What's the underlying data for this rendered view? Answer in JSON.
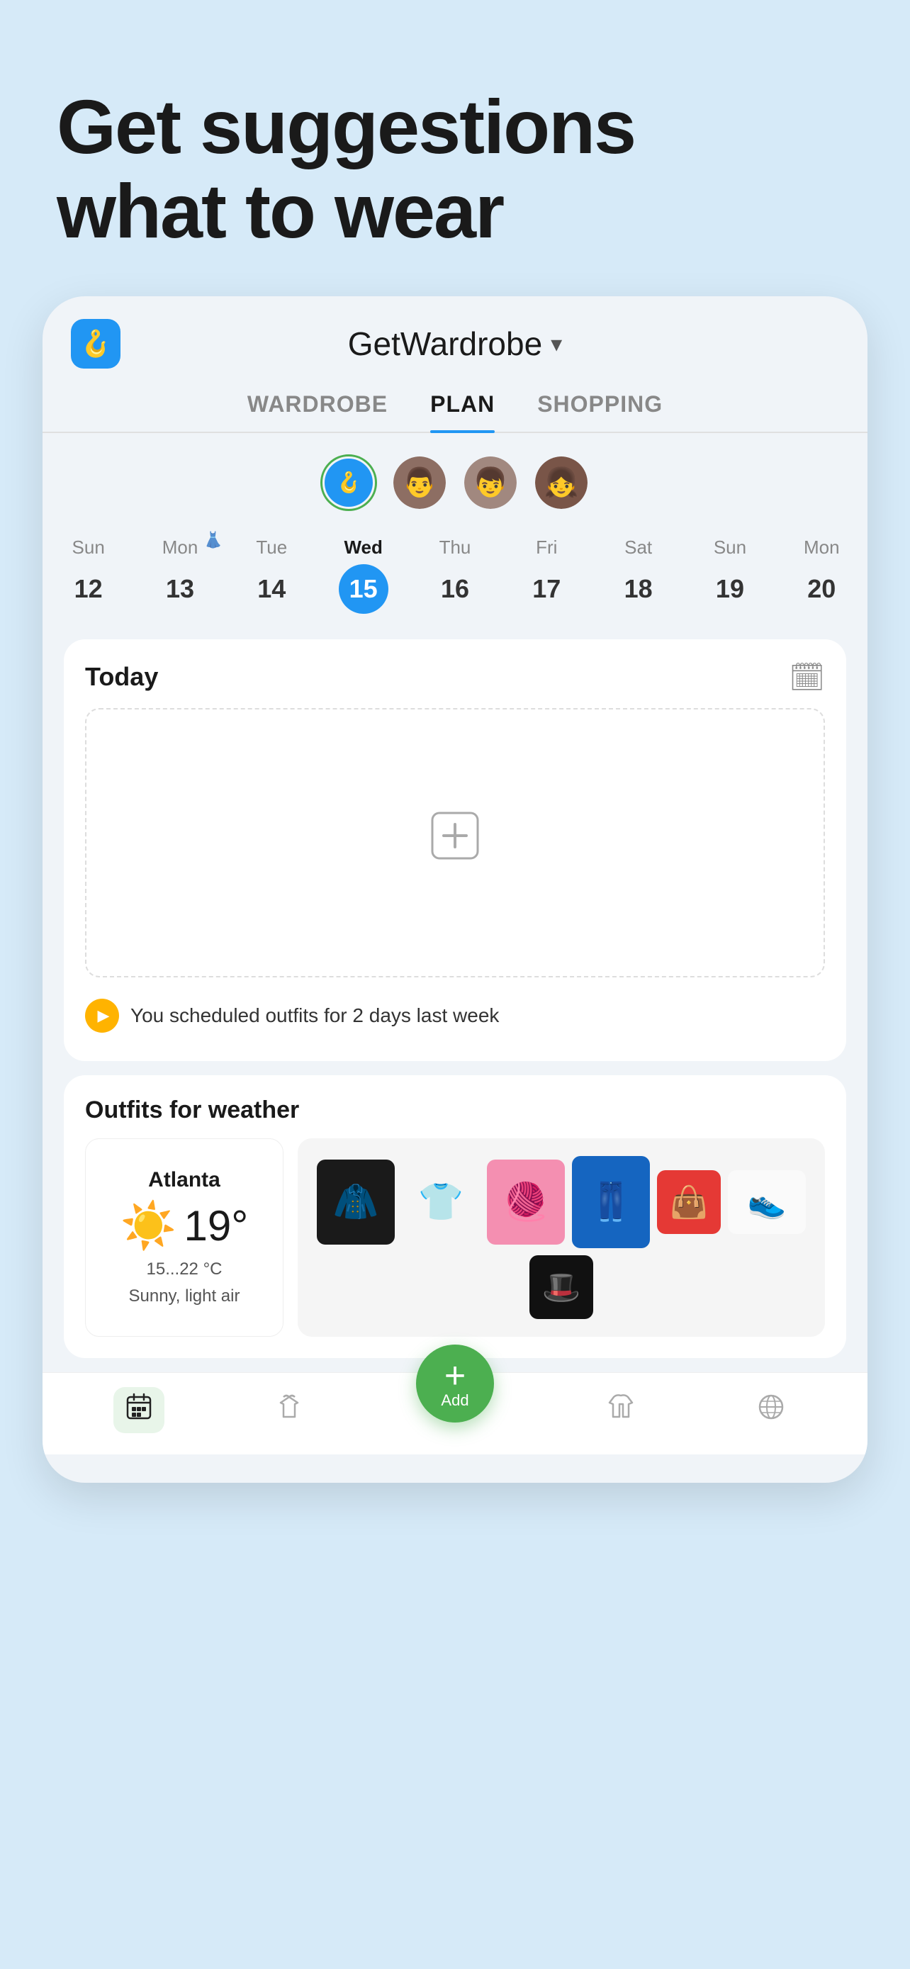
{
  "hero": {
    "title_line1": "Get suggestions",
    "title_line2": "what to wear"
  },
  "app": {
    "name": "GetWardrobe",
    "logo_icon": "🧥"
  },
  "tabs": [
    {
      "id": "wardrobe",
      "label": "WARDROBE",
      "active": false
    },
    {
      "id": "plan",
      "label": "PLAN",
      "active": true
    },
    {
      "id": "shopping",
      "label": "SHOPPING",
      "active": false
    }
  ],
  "avatars": [
    {
      "id": "self",
      "type": "hanger",
      "active": true
    },
    {
      "id": "person1",
      "type": "photo",
      "initials": "👨"
    },
    {
      "id": "person2",
      "type": "photo",
      "initials": "👦"
    },
    {
      "id": "person3",
      "type": "photo",
      "initials": "👧"
    }
  ],
  "calendar": {
    "days": [
      {
        "name": "Sun",
        "num": "12",
        "today": false,
        "has_outfit": false
      },
      {
        "name": "Mon",
        "num": "13",
        "today": false,
        "has_outfit": true
      },
      {
        "name": "Tue",
        "num": "14",
        "today": false,
        "has_outfit": false
      },
      {
        "name": "Wed",
        "num": "15",
        "today": true,
        "has_outfit": false
      },
      {
        "name": "Thu",
        "num": "16",
        "today": false,
        "has_outfit": false
      },
      {
        "name": "Fri",
        "num": "17",
        "today": false,
        "has_outfit": false
      },
      {
        "name": "Sat",
        "num": "18",
        "today": false,
        "has_outfit": false
      },
      {
        "name": "Sun",
        "num": "19",
        "today": false,
        "has_outfit": false
      },
      {
        "name": "Mon",
        "num": "20",
        "today": false,
        "has_outfit": false
      }
    ]
  },
  "today_card": {
    "label": "Today",
    "empty_state": "",
    "notice": "You scheduled outfits for 2 days last week"
  },
  "weather_section": {
    "title": "Outfits for weather",
    "city": "Atlanta",
    "temperature": "19°",
    "range": "15...22 °C",
    "description": "Sunny, light air"
  },
  "bottom_nav": [
    {
      "id": "plan",
      "icon": "📅",
      "label": "",
      "active": true
    },
    {
      "id": "wardrobe",
      "icon": "👗",
      "label": "",
      "active": false
    },
    {
      "id": "add",
      "icon": "+",
      "label": "Add",
      "is_fab": true
    },
    {
      "id": "outfits",
      "icon": "👔",
      "label": "",
      "active": false
    },
    {
      "id": "explore",
      "icon": "🌐",
      "label": "",
      "active": false
    }
  ]
}
